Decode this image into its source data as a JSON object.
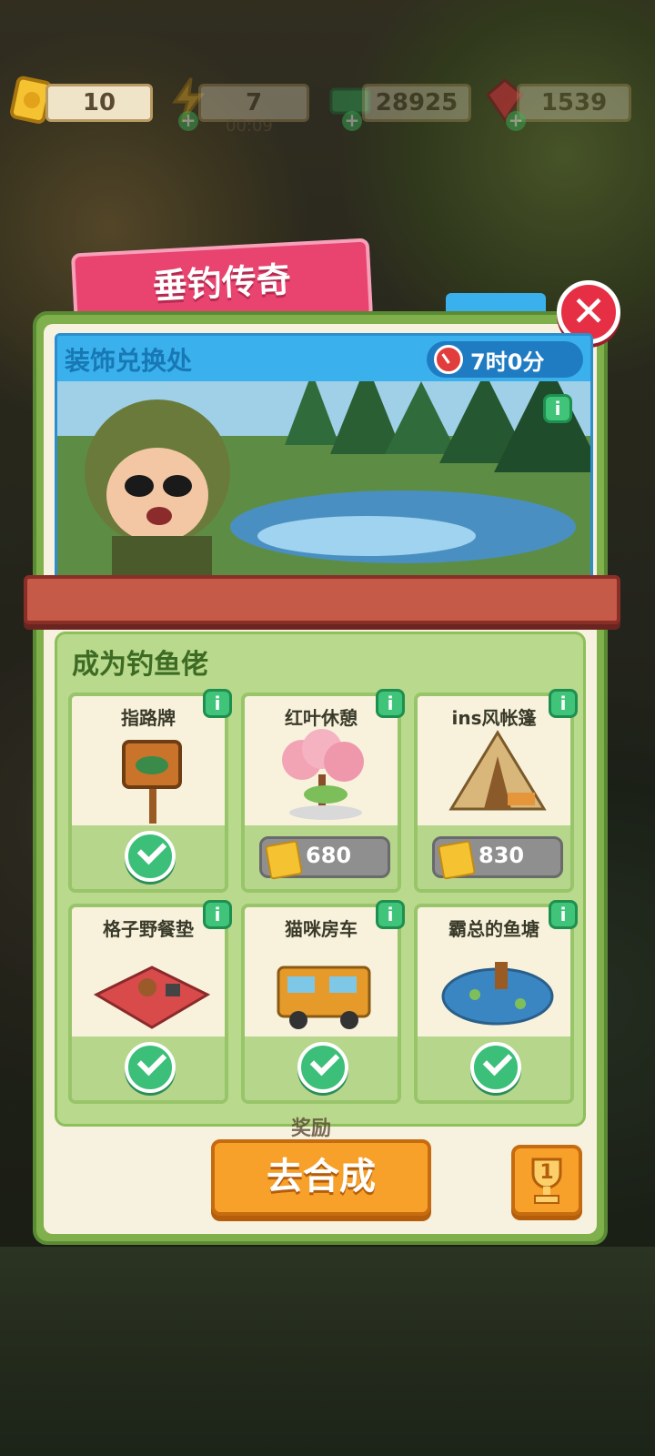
{
  "hud": {
    "tickets": "10",
    "energy": "7",
    "energy_timer": "00:09",
    "cash": "28925",
    "gems": "1539"
  },
  "title": "垂钓传奇",
  "banner": {
    "title": "装饰兑换处",
    "timer": "7时0分"
  },
  "section": {
    "title": "成为钓鱼佬",
    "items": [
      {
        "name": "指路牌",
        "state": "owned"
      },
      {
        "name": "红叶休憩",
        "state": "price",
        "price": "680"
      },
      {
        "name": "ins风帐篷",
        "state": "price",
        "price": "830"
      },
      {
        "name": "格子野餐垫",
        "state": "owned"
      },
      {
        "name": "猫咪房车",
        "state": "owned"
      },
      {
        "name": "霸总的鱼塘",
        "state": "owned"
      }
    ]
  },
  "reward_label": "奖励",
  "go_button": "去合成",
  "trophy_count": "1",
  "colors": {
    "title_pink": "#e9436f",
    "panel_green": "#7fb04c",
    "banner_blue": "#3ab1ec",
    "button_orange": "#f7a02a",
    "check_green": "#3cbf78"
  }
}
